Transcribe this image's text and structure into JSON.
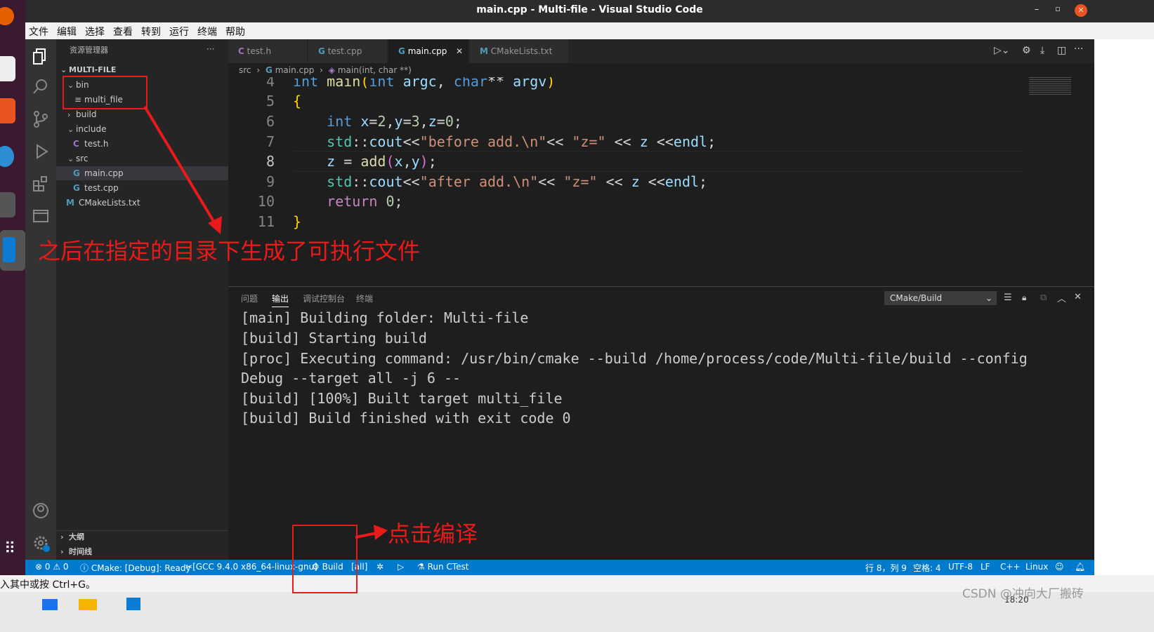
{
  "window": {
    "title": "main.cpp - Multi-file - Visual Studio Code"
  },
  "menu": [
    "文件",
    "编辑",
    "选择",
    "查看",
    "转到",
    "运行",
    "终端",
    "帮助"
  ],
  "explorer": {
    "header": "资源管理器",
    "root": "MULTI-FILE",
    "items": [
      {
        "label": "bin",
        "kind": "folder-open"
      },
      {
        "label": "multi_file",
        "kind": "file"
      },
      {
        "label": "build",
        "kind": "folder"
      },
      {
        "label": "include",
        "kind": "folder-open"
      },
      {
        "label": "test.h",
        "kind": "c"
      },
      {
        "label": "src",
        "kind": "folder-open"
      },
      {
        "label": "main.cpp",
        "kind": "cpp"
      },
      {
        "label": "test.cpp",
        "kind": "cpp"
      },
      {
        "label": "CMakeLists.txt",
        "kind": "cmake"
      }
    ],
    "outline": "大纲",
    "timeline": "时间线"
  },
  "tabs": [
    {
      "label": "test.h",
      "icon": "C"
    },
    {
      "label": "test.cpp",
      "icon": "G"
    },
    {
      "label": "main.cpp",
      "icon": "G"
    },
    {
      "label": "CMakeLists.txt",
      "icon": "M"
    }
  ],
  "breadcrumb": {
    "folder": "src",
    "file": "main.cpp",
    "symbol": "main(int, char **)"
  },
  "editor": {
    "line_numbers": [
      "4",
      "5",
      "6",
      "7",
      "8",
      "9",
      "10",
      "11"
    ]
  },
  "panel": {
    "tabs": [
      "问题",
      "输出",
      "调试控制台",
      "终端"
    ],
    "channel": "CMake/Build",
    "output": [
      "[main] Building folder: Multi-file",
      "[build] Starting build",
      "[proc] Executing command: /usr/bin/cmake --build /home/process/code/Multi-file/build --config",
      "Debug --target all -j 6 --",
      "[build] [100%] Built target multi_file",
      "[build] Build finished with exit code 0"
    ]
  },
  "statusbar": {
    "problems": "⊗ 0 ⚠ 0",
    "cmake": "CMake: [Debug]: Ready",
    "kit": "[GCC 9.4.0 x86_64-linux-gnu]",
    "build": "Build",
    "target": "[all]",
    "ctest": "Run CTest",
    "position": "行 8，列 9",
    "spaces": "空格: 4",
    "encoding": "UTF-8",
    "eol": "LF",
    "language": "C++",
    "os": "Linux"
  },
  "hint": "入其中或按 Ctrl+G。",
  "annotations": {
    "dir_note": "之后在指定的目录下生成了可执行文件",
    "build_note": "点击编译"
  },
  "watermark": "CSDN @冲向大厂搬砖",
  "clock": "18:20"
}
